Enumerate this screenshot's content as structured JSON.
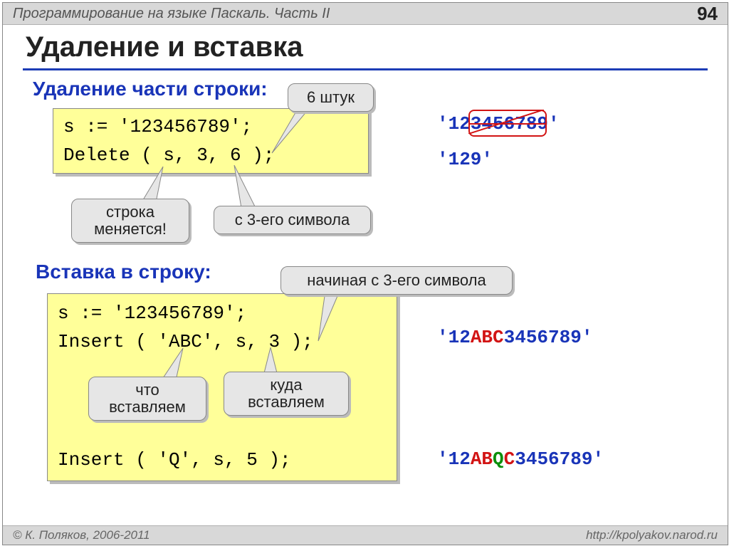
{
  "topbar": {
    "title": "Программирование на языке Паскаль. Часть II",
    "pagenum": "94"
  },
  "footer": {
    "left": "© К. Поляков, 2006-2011",
    "right": "http://kpolyakov.narod.ru"
  },
  "title": "Удаление и вставка",
  "section1": {
    "head": "Удаление части строки:",
    "code_line1": "s := '123456789';",
    "code_line2": "Delete ( s, 3, 6 );",
    "callout_count": "6 штук",
    "callout_changes": "строка\nменяется!",
    "callout_from3": "с 3-его символа",
    "result_full": "'123456789'",
    "result_after": "'129'"
  },
  "section2": {
    "head": "Вставка в строку:",
    "callout_from3": "начиная с 3-его символа",
    "code_line1": "s := '123456789';",
    "code_line2": "Insert ( 'ABC', s, 3 );",
    "code_line3": "Insert ( 'Q', s, 5 );",
    "callout_what": "что\nвставляем",
    "callout_where": "куда\nвставляем",
    "result1_pre": "'12",
    "result1_ins": "ABC",
    "result1_post": "3456789'",
    "result2_pre": "'12",
    "result2_abc_a": "AB",
    "result2_q": "Q",
    "result2_abc_c": "C",
    "result2_post": "3456789'"
  }
}
